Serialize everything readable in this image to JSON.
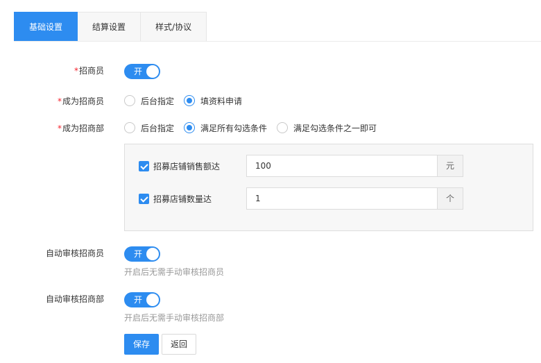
{
  "tabs": [
    {
      "label": "基础设置",
      "active": true
    },
    {
      "label": "结算设置",
      "active": false
    },
    {
      "label": "样式/协议",
      "active": false
    }
  ],
  "fields": {
    "recruiter": {
      "required_mark": "*",
      "label": "招商员",
      "switch_text": "开"
    },
    "become_recruiter": {
      "required_mark": "*",
      "label": "成为招商员",
      "options": [
        {
          "label": "后台指定",
          "checked": false
        },
        {
          "label": "填资料申请",
          "checked": true
        }
      ]
    },
    "become_dept": {
      "required_mark": "*",
      "label": "成为招商部",
      "options": [
        {
          "label": "后台指定",
          "checked": false
        },
        {
          "label": "满足所有勾选条件",
          "checked": true
        },
        {
          "label": "满足勾选条件之一即可",
          "checked": false
        }
      ]
    },
    "conditions": [
      {
        "label": "招募店铺销售额达",
        "checked": true,
        "value": "100",
        "unit": "元"
      },
      {
        "label": "招募店铺数量达",
        "checked": true,
        "value": "1",
        "unit": "个"
      }
    ],
    "auto_audit_recruiter": {
      "label": "自动审核招商员",
      "switch_text": "开",
      "hint": "开启后无需手动审核招商员"
    },
    "auto_audit_dept": {
      "label": "自动审核招商部",
      "switch_text": "开",
      "hint": "开启后无需手动审核招商部"
    }
  },
  "actions": {
    "save_label": "保存",
    "back_label": "返回"
  },
  "colors": {
    "accent": "#2d8cf0",
    "required": "#f5222d",
    "hint": "#999999"
  },
  "icons": {
    "checkbox": "check-icon",
    "switch": "toggle-knob"
  }
}
